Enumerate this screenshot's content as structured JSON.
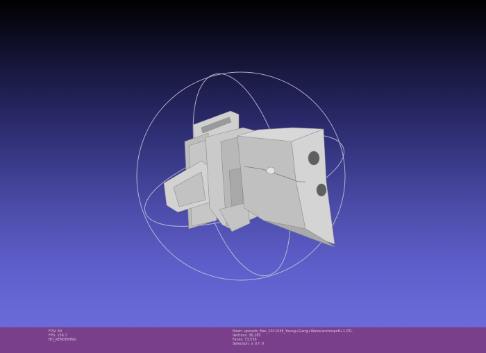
{
  "viewer": {
    "colors": {
      "background_top": "#000000",
      "background_bottom": "#6a6ad9",
      "status_bar": "#7a3f8a",
      "model": "#c9c9c9",
      "trackball": "#c8c8dc"
    },
    "icons": {
      "trackball": "trackball-icon",
      "model": "mesh-model"
    }
  },
  "status": {
    "left": {
      "fov": "FOV: 60",
      "fps": "FPS: 156.7",
      "rendering": "BO_RENDERING"
    },
    "right": {
      "mesh": "Mesh: uploads_files_2011036_Young+Gang+Wake(anchorpo8+1.STL",
      "vertices": "Vertices: 36,282",
      "faces": "Faces: 73,536",
      "selection": "Selection: v: 0 f: 0"
    }
  }
}
